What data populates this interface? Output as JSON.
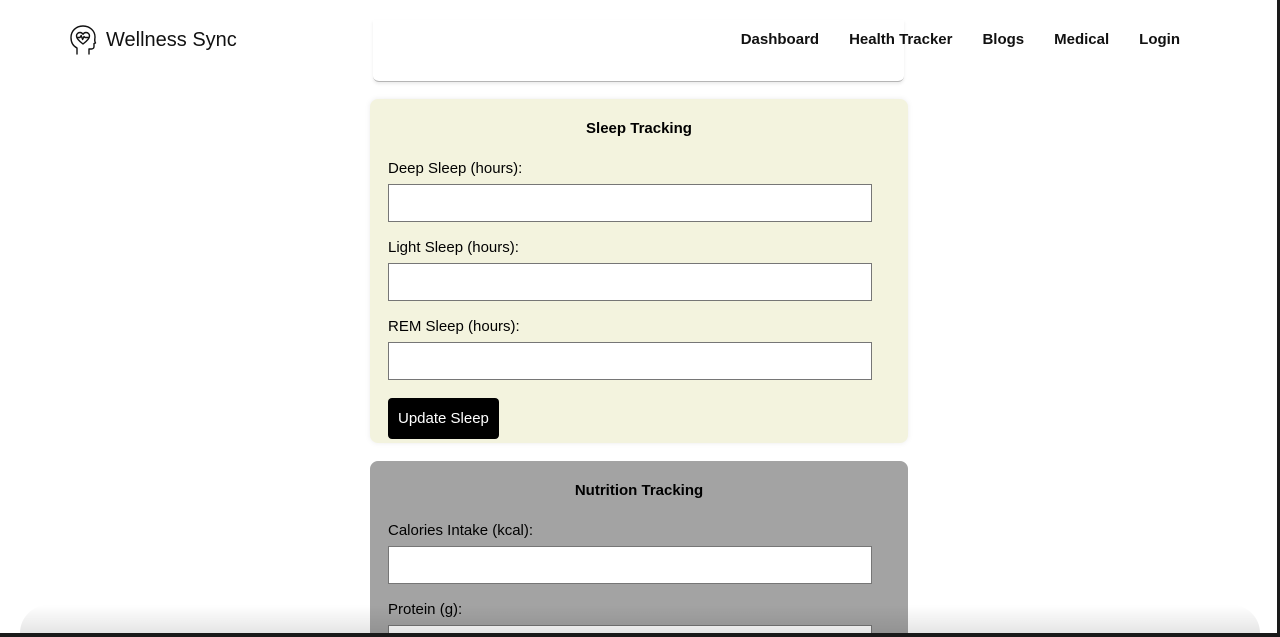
{
  "header": {
    "brand_name": "Wellness Sync",
    "logo_icon": "head-heart-icon",
    "nav": [
      {
        "label": "Dashboard"
      },
      {
        "label": "Health Tracker"
      },
      {
        "label": "Blogs"
      },
      {
        "label": "Medical"
      },
      {
        "label": "Login"
      }
    ]
  },
  "sleep": {
    "title": "Sleep Tracking",
    "fields": [
      {
        "label": "Deep Sleep (hours):",
        "value": ""
      },
      {
        "label": "Light Sleep (hours):",
        "value": ""
      },
      {
        "label": "REM Sleep (hours):",
        "value": ""
      }
    ],
    "button_label": "Update Sleep",
    "background": "#f3f3de"
  },
  "nutrition": {
    "title": "Nutrition Tracking",
    "fields": [
      {
        "label": "Calories Intake (kcal):",
        "value": ""
      },
      {
        "label": "Protein (g):",
        "value": ""
      }
    ],
    "background": "#a3a3a3"
  },
  "colors": {
    "button_bg": "#000000",
    "button_text": "#ffffff"
  }
}
